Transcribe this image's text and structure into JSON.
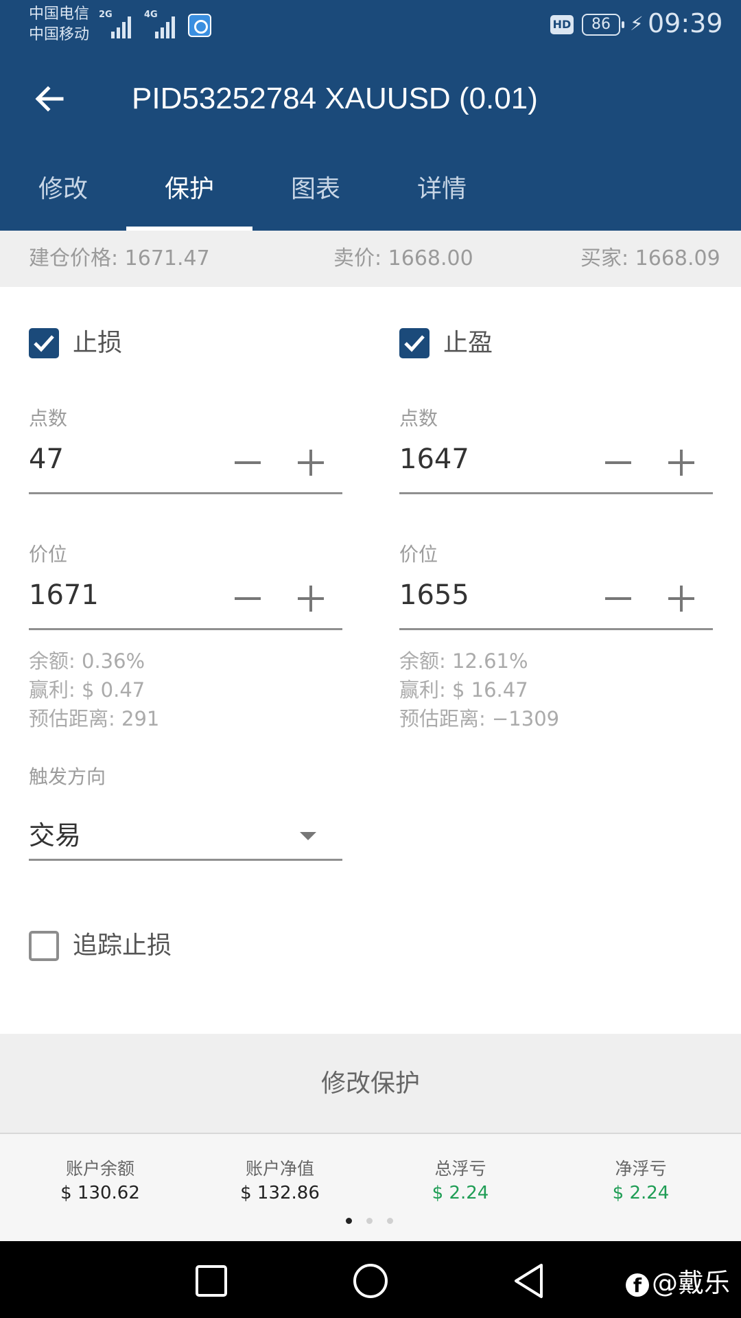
{
  "status_bar": {
    "carrier_1": "中国电信",
    "carrier_2": "中国移动",
    "network_1": "2G",
    "network_2": "4G",
    "hd": "HD",
    "battery": "86",
    "time": "09:39"
  },
  "header": {
    "title": "PID53252784 XAUUSD (0.01)",
    "tabs": [
      {
        "label": "修改"
      },
      {
        "label": "保护"
      },
      {
        "label": "图表"
      },
      {
        "label": "详情"
      }
    ],
    "active_tab": 1
  },
  "price_bar": {
    "open_price": "建仓价格:   1671.47",
    "sell_price": "卖价: 1668.00",
    "buy_price": "买家: 1668.09"
  },
  "stop_loss": {
    "label": "止损",
    "checked": true,
    "points_label": "点数",
    "points_value": "47",
    "price_label": "价位",
    "price_value": "1671",
    "balance": "余额: 0.36%",
    "profit": "赢利: $ 0.47",
    "distance": "预估距离:   291"
  },
  "take_profit": {
    "label": "止盈",
    "checked": true,
    "points_label": "点数",
    "points_value": "1647",
    "price_label": "价位",
    "price_value": "1655",
    "balance": "余额: 12.61%",
    "profit": "赢利: $ 16.47",
    "distance": "预估距离:   −1309"
  },
  "trigger": {
    "label": "触发方向",
    "selected": "交易"
  },
  "trailing_stop": {
    "label": "追踪止损",
    "checked": false
  },
  "submit_button": "修改保护",
  "summary": {
    "items": [
      {
        "label": "账户余额",
        "value": "$ 130.62",
        "color": "#222222"
      },
      {
        "label": "账户净值",
        "value": "$ 132.86",
        "color": "#222222"
      },
      {
        "label": "总浮亏",
        "value": "$ 2.24",
        "color": "#1f9d55"
      },
      {
        "label": "净浮亏",
        "value": "$ 2.24",
        "color": "#1f9d55"
      }
    ],
    "page_count": 3,
    "active_page": 1
  },
  "watermark": "@戴乐",
  "colors": {
    "brand": "#1b4a7a",
    "profit_green": "#1f9d55"
  }
}
